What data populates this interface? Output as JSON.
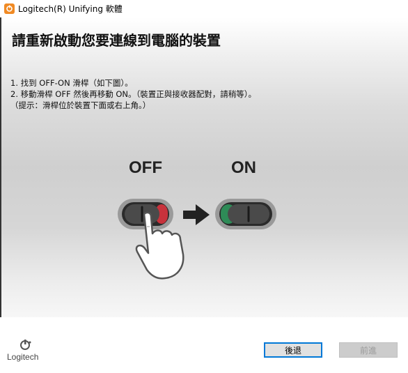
{
  "window": {
    "title": "Logitech(R) Unifying 軟體",
    "accent": "#f08a24"
  },
  "main": {
    "heading": "請重新啟動您要連線到電腦的裝置",
    "steps": [
      "1. 找到 OFF-ON 滑桿（如下圖）。",
      "2. 移動滑桿 OFF 然後再移動 ON。（裝置正與接收器配對，請稍等）。",
      "（提示：滑桿位於裝置下面或右上角。）"
    ],
    "illustration": {
      "off_label": "OFF",
      "on_label": "ON",
      "off_accent": "#c8323c",
      "on_accent": "#2e8b57"
    }
  },
  "footer": {
    "logo_text": "Logitech",
    "back_label": "後退",
    "next_label": "前進"
  }
}
